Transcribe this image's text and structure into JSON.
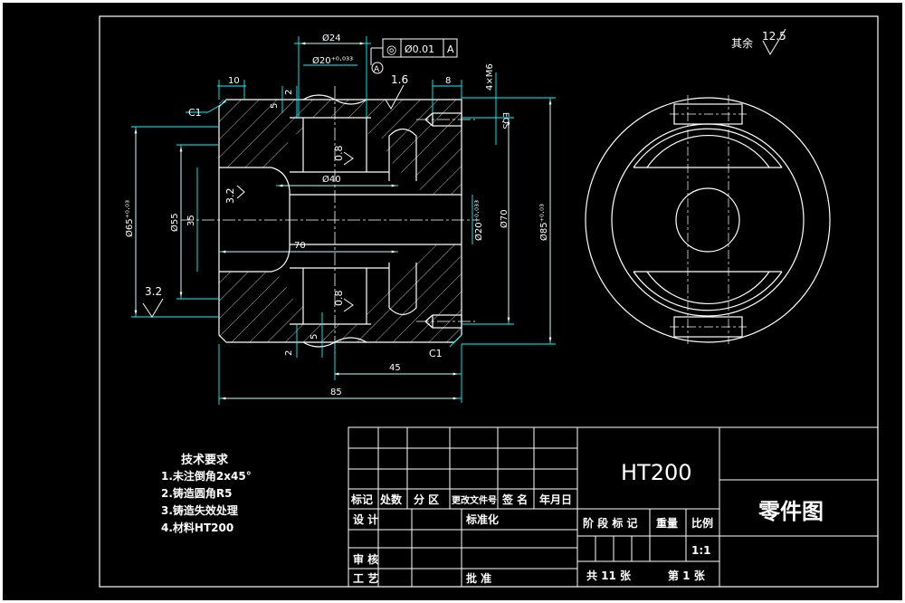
{
  "drawing": {
    "material": "HT200",
    "title": "零件图",
    "scale": "1:1",
    "sheets_total": "共 11 张",
    "sheet_no": "第 1 张"
  },
  "roughness": {
    "rest": "其余",
    "rest_value": "12.5",
    "r1_6": "1.6",
    "r0_8": "0.8",
    "r3_2": "3.2"
  },
  "tolerance_frame": {
    "symbol": "◎",
    "value": "Ø0.01",
    "datum": "A",
    "datum_marker": "A"
  },
  "dimensions": {
    "d24": "Ø24",
    "d20": "Ø20⁺⁰·⁰³³",
    "d20_right": "Ø20⁺⁰·⁰³³",
    "d40": "Ø40",
    "d55": "Ø55",
    "d65": "Ø65⁺⁰·⁰³",
    "d70": "Ø70",
    "d85": "Ø85⁺⁰·⁰³",
    "l10": "10",
    "l8": "8",
    "l2a": "2",
    "l5a": "5",
    "l2b": "2",
    "l5b": "5",
    "l35": "35",
    "l70": "70",
    "l45": "45",
    "l85": "85",
    "thread": "4×M6",
    "eqs": "EQS",
    "chamfer1": "C1",
    "chamfer2": "C1"
  },
  "tech_requirements": {
    "heading": "技术要求",
    "items": [
      "1.未注倒角2x45°",
      "2.铸造圆角R5",
      "3.铸造失效处理",
      "4.材料HT200"
    ]
  },
  "title_block": {
    "revision_headers": [
      "标记",
      "处数",
      "分 区",
      "更改文件号",
      "签 名",
      "年月日"
    ],
    "design": "设 计",
    "standardize": "标准化",
    "review": "审 核",
    "process": "工 艺",
    "approve": "批 准",
    "stage_marks": "阶 段 标 记",
    "weight": "重量",
    "ratio": "比例"
  },
  "colors": {
    "background": "#000000",
    "outline": "#ffffff",
    "dimension": "#00ffff",
    "text": "#ffffff"
  }
}
